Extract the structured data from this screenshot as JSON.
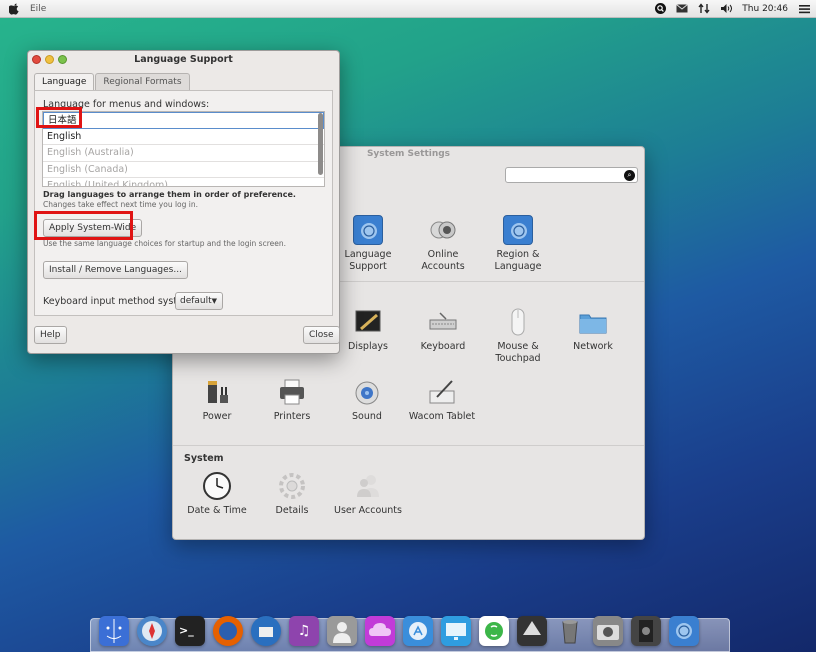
{
  "menubar": {
    "app_name": "Eile",
    "clock": "Thu 20:46",
    "icons": [
      "apple-logo",
      "search-icon",
      "mail-icon",
      "network-icon",
      "volume-icon",
      "menu-icon"
    ]
  },
  "system_settings": {
    "title": "System Settings",
    "search_placeholder": "",
    "personal_items": [
      {
        "label": "Language Support",
        "icon": "language-support-icon"
      },
      {
        "label": "Online Accounts",
        "icon": "online-accounts-icon"
      },
      {
        "label": "Region & Language",
        "icon": "region-language-icon"
      }
    ],
    "hardware_items": [
      {
        "label": "Displays",
        "icon": "displays-icon"
      },
      {
        "label": "Keyboard",
        "icon": "keyboard-icon"
      },
      {
        "label": "Mouse & Touchpad",
        "icon": "mouse-icon"
      },
      {
        "label": "Network",
        "icon": "network-folder-icon"
      },
      {
        "label": "Power",
        "icon": "power-icon"
      },
      {
        "label": "Printers",
        "icon": "printer-icon"
      },
      {
        "label": "Sound",
        "icon": "sound-icon"
      },
      {
        "label": "Wacom Tablet",
        "icon": "wacom-tablet-icon"
      }
    ],
    "system_section": {
      "heading": "System",
      "items": [
        {
          "label": "Date & Time",
          "icon": "clock-icon"
        },
        {
          "label": "Details",
          "icon": "gear-icon"
        },
        {
          "label": "User Accounts",
          "icon": "users-icon"
        }
      ]
    }
  },
  "language_support": {
    "title": "Language Support",
    "tabs": [
      {
        "label": "Language",
        "active": true
      },
      {
        "label": "Regional Formats",
        "active": false
      }
    ],
    "list_label": "Language for menus and windows:",
    "languages": [
      {
        "label": "日本語",
        "enabled": true
      },
      {
        "label": "English",
        "enabled": true
      },
      {
        "label": "English (Australia)",
        "enabled": false
      },
      {
        "label": "English (Canada)",
        "enabled": false
      },
      {
        "label": "English (United Kingdom)",
        "enabled": false
      }
    ],
    "drag_hint": "Drag languages to arrange them in order of preference.",
    "changes_hint": "Changes take effect next time you log in.",
    "apply_button": "Apply System-Wide",
    "apply_hint": "Use the same language choices for startup and the login screen.",
    "install_button": "Install / Remove Languages...",
    "keyboard_label": "Keyboard input method system:",
    "keyboard_value": "default",
    "help_button": "Help",
    "close_button": "Close"
  },
  "dock": {
    "apps": [
      {
        "name": "finder-icon",
        "color": "#3b6fd6"
      },
      {
        "name": "safari-icon",
        "color": "#4a86c9"
      },
      {
        "name": "terminal-icon",
        "color": "#222222"
      },
      {
        "name": "firefox-icon",
        "color": "#e66000"
      },
      {
        "name": "thunderbird-icon",
        "color": "#2a6fbf"
      },
      {
        "name": "itunes-icon",
        "color": "#8e44ad"
      },
      {
        "name": "contacts-icon",
        "color": "#9a9a9a"
      },
      {
        "name": "cloud-icon",
        "color": "#c23bd8"
      },
      {
        "name": "app-store-icon",
        "color": "#3a8edb"
      },
      {
        "name": "monitor-icon",
        "color": "#2f9de0"
      },
      {
        "name": "skype-icon",
        "color": "#3cb649"
      },
      {
        "name": "inkscape-icon",
        "color": "#333333"
      },
      {
        "name": "trash-icon",
        "color": "#666666"
      },
      {
        "name": "camera-icon",
        "color": "#888888"
      },
      {
        "name": "film-icon",
        "color": "#444444"
      },
      {
        "name": "language-support-icon",
        "color": "#3a7fd0"
      }
    ]
  }
}
